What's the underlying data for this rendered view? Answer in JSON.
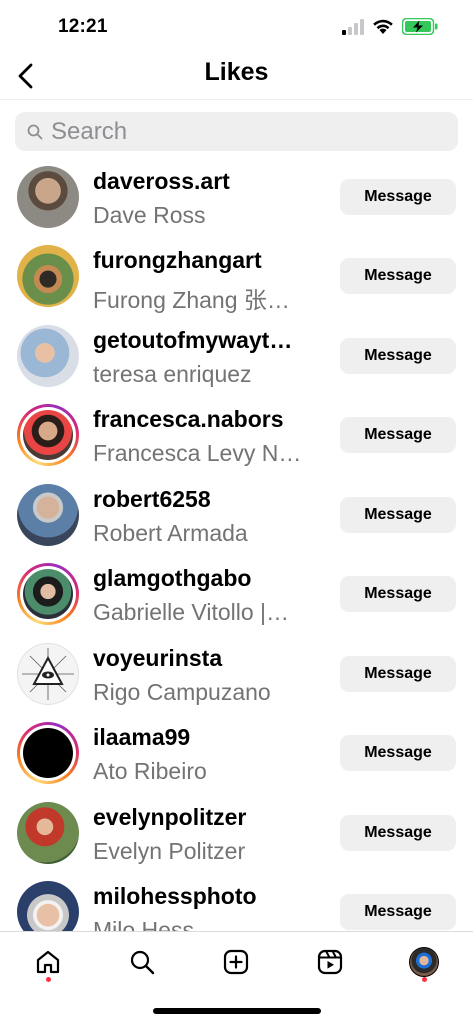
{
  "status_bar": {
    "time": "12:21"
  },
  "header": {
    "title": "Likes",
    "back_icon": "chevron-left-icon"
  },
  "search": {
    "placeholder": "Search",
    "value": ""
  },
  "colors": {
    "secondary_text": "#737373",
    "button_bg": "#efeff0",
    "notification_dot": "#ff3040",
    "battery_green": "#34c759"
  },
  "users": [
    {
      "username": "daveross.art",
      "full_name": "Dave Ross",
      "button_label": "Message",
      "story_ring": false
    },
    {
      "username": "furongzhangart",
      "full_name": "Furong Zhang 张…",
      "button_label": "Message",
      "story_ring": false
    },
    {
      "username": "getoutofmywayt…",
      "full_name": "teresa enriquez",
      "button_label": "Message",
      "story_ring": false
    },
    {
      "username": "francesca.nabors",
      "full_name": "Francesca Levy N…",
      "button_label": "Message",
      "story_ring": true
    },
    {
      "username": "robert6258",
      "full_name": "Robert Armada",
      "button_label": "Message",
      "story_ring": false
    },
    {
      "username": "glamgothgabo",
      "full_name": "Gabrielle Vitollo |…",
      "button_label": "Message",
      "story_ring": true
    },
    {
      "username": "voyeurinsta",
      "full_name": "Rigo Campuzano",
      "button_label": "Message",
      "story_ring": false
    },
    {
      "username": "ilaama99",
      "full_name": "Ato Ribeiro",
      "button_label": "Message",
      "story_ring": true
    },
    {
      "username": "evelynpolitzer",
      "full_name": "Evelyn Politzer",
      "button_label": "Message",
      "story_ring": false
    },
    {
      "username": "milohessphoto",
      "full_name": "Milo Hess",
      "button_label": "Message",
      "story_ring": false
    }
  ],
  "tab_bar": {
    "items": [
      {
        "icon": "home-icon",
        "has_dot": true
      },
      {
        "icon": "search-icon",
        "has_dot": false
      },
      {
        "icon": "create-post-icon",
        "has_dot": false
      },
      {
        "icon": "reels-icon",
        "has_dot": false
      },
      {
        "icon": "profile-avatar",
        "has_dot": true
      }
    ]
  }
}
